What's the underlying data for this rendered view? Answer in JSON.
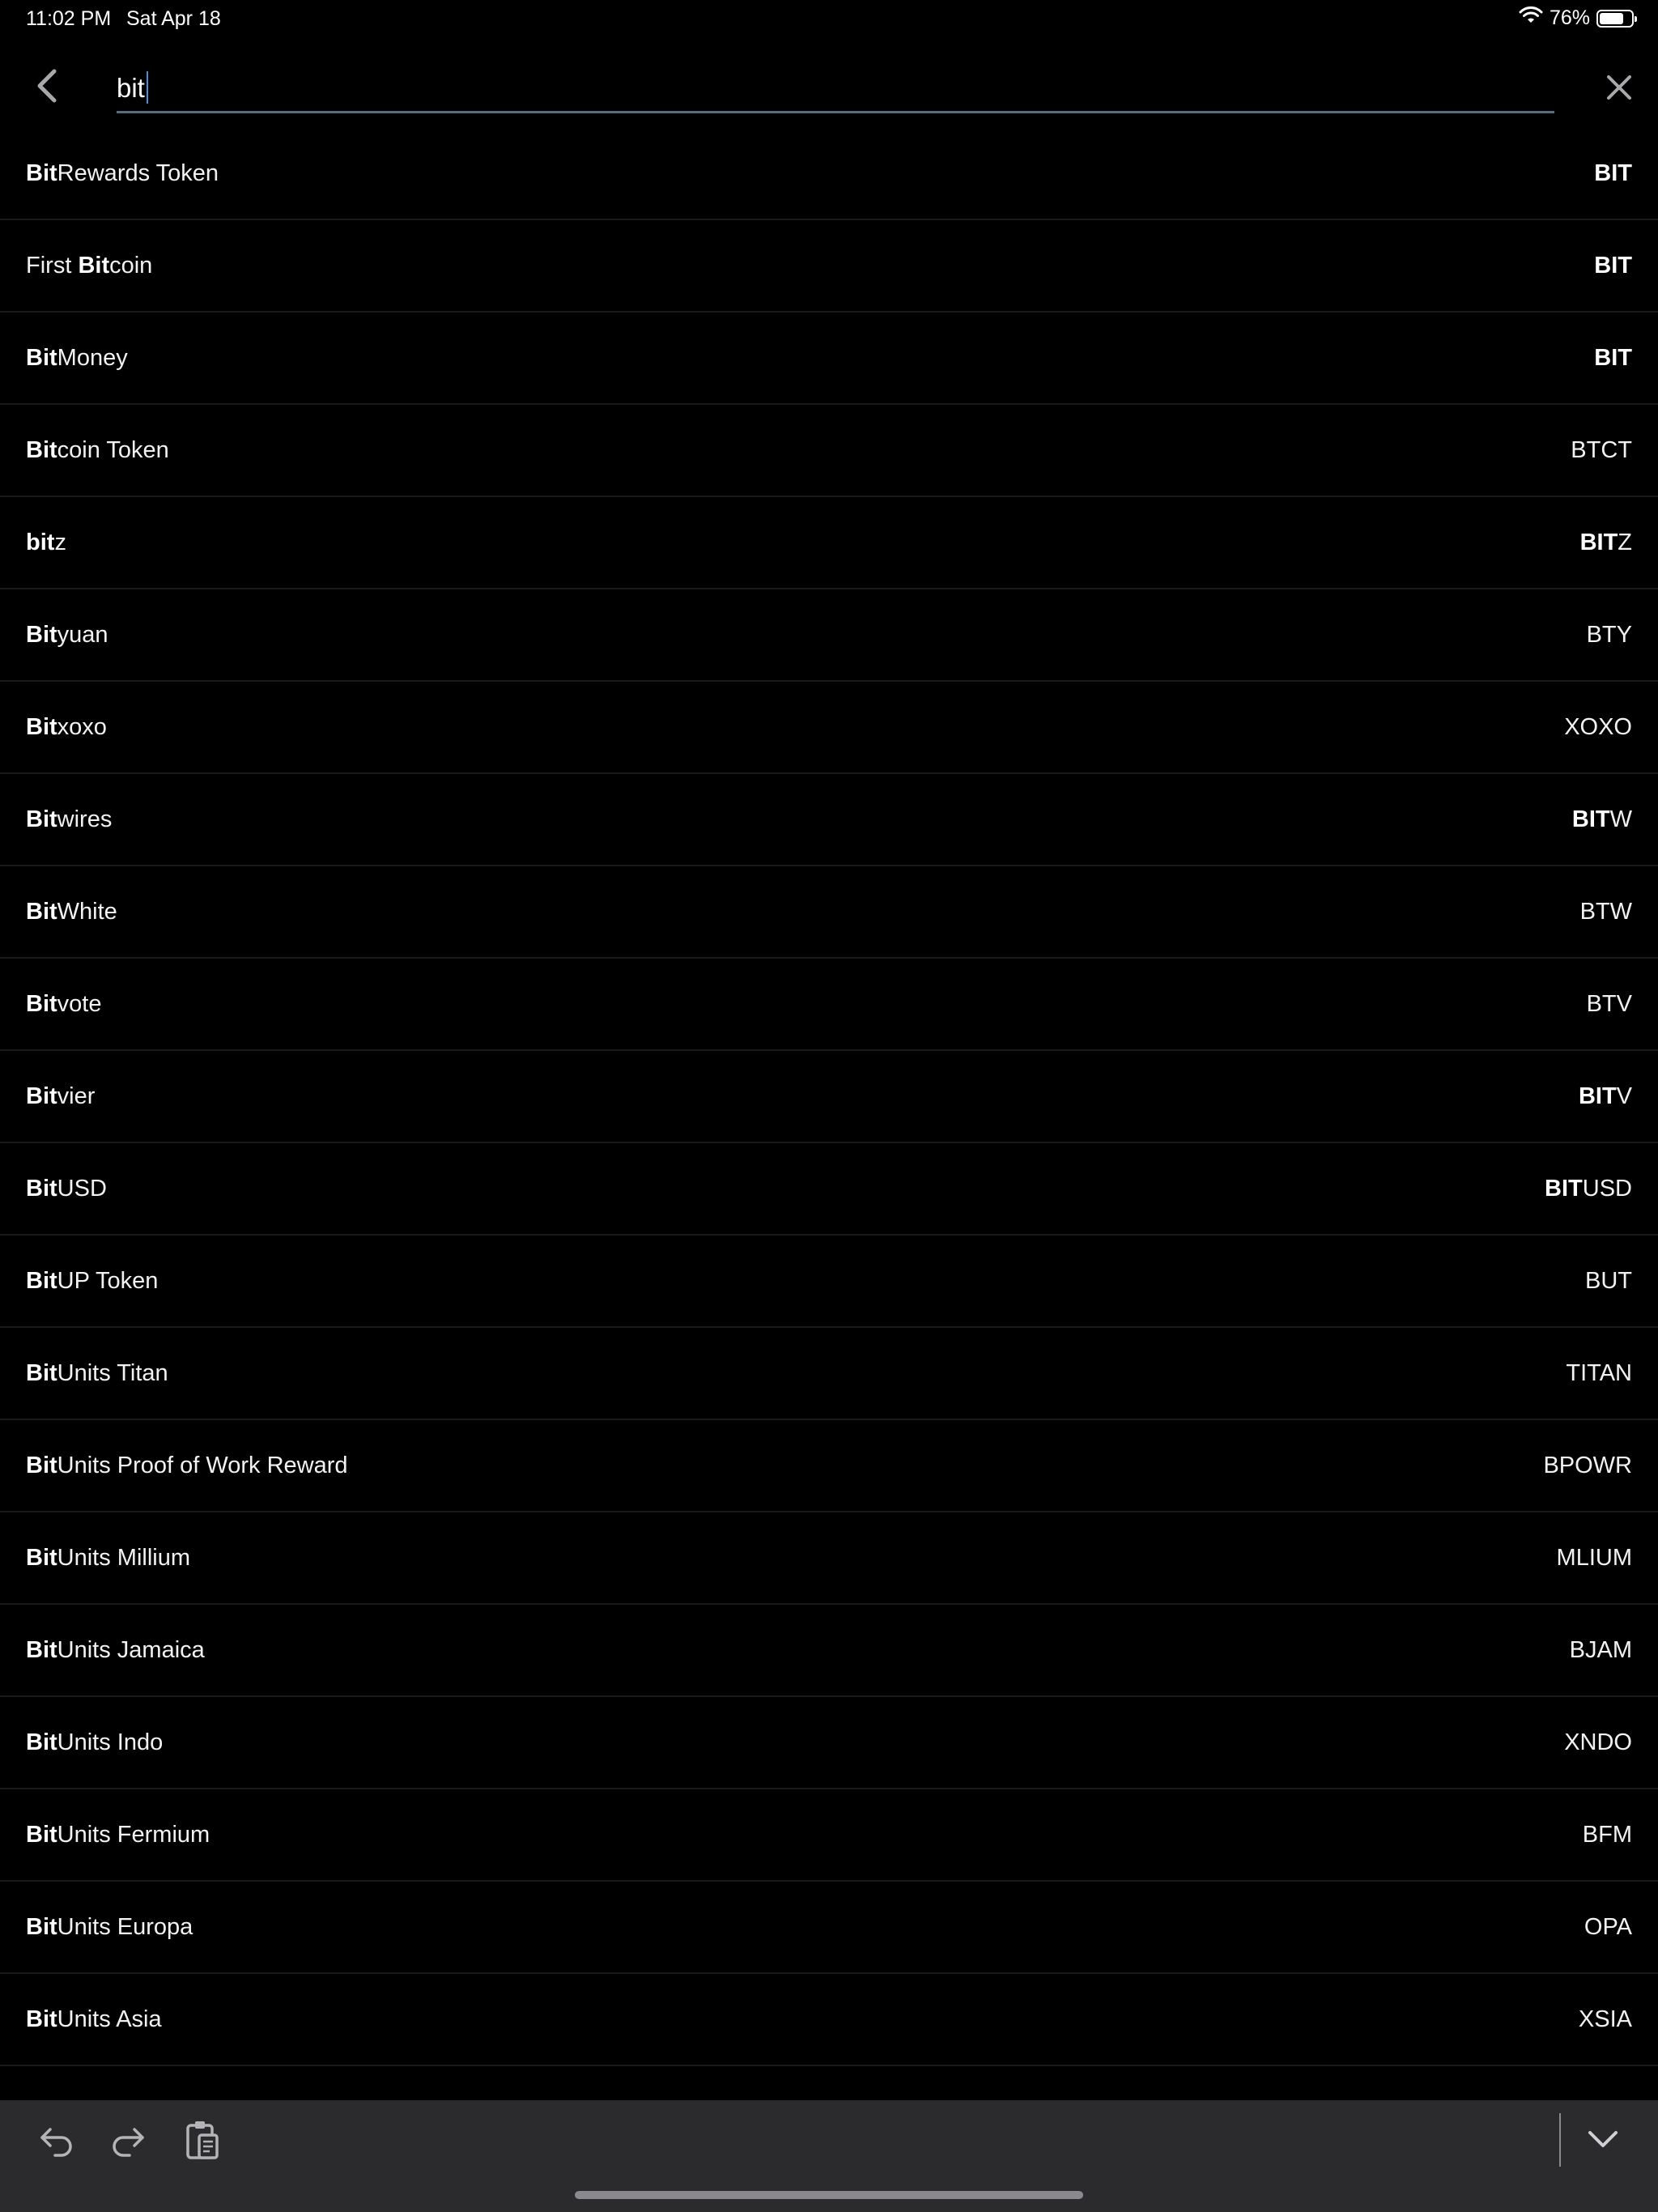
{
  "status": {
    "time": "11:02 PM",
    "date": "Sat Apr 18",
    "battery": "76%",
    "battery_level": 0.76
  },
  "search": {
    "query": "bit",
    "back_icon": "chevron-left-icon",
    "clear_icon": "close-icon"
  },
  "results": [
    {
      "name_pre": "",
      "name_bold": "Bit",
      "name_post": "Rewards Token",
      "sym_bold": "BIT",
      "sym_post": ""
    },
    {
      "name_pre": "First ",
      "name_bold": "Bit",
      "name_post": "coin",
      "sym_bold": "BIT",
      "sym_post": ""
    },
    {
      "name_pre": "",
      "name_bold": "Bit",
      "name_post": "Money",
      "sym_bold": "BIT",
      "sym_post": ""
    },
    {
      "name_pre": "",
      "name_bold": "Bit",
      "name_post": "coin Token",
      "sym_bold": "",
      "sym_post": "BTCT"
    },
    {
      "name_pre": "",
      "name_bold": "bit",
      "name_post": "z",
      "sym_bold": "BIT",
      "sym_post": "Z"
    },
    {
      "name_pre": "",
      "name_bold": "Bit",
      "name_post": "yuan",
      "sym_bold": "",
      "sym_post": "BTY"
    },
    {
      "name_pre": "",
      "name_bold": "Bit",
      "name_post": "xoxo",
      "sym_bold": "",
      "sym_post": "XOXO"
    },
    {
      "name_pre": "",
      "name_bold": "Bit",
      "name_post": "wires",
      "sym_bold": "BIT",
      "sym_post": "W"
    },
    {
      "name_pre": "",
      "name_bold": "Bit",
      "name_post": "White",
      "sym_bold": "",
      "sym_post": "BTW"
    },
    {
      "name_pre": "",
      "name_bold": "Bit",
      "name_post": "vote",
      "sym_bold": "",
      "sym_post": "BTV"
    },
    {
      "name_pre": "",
      "name_bold": "Bit",
      "name_post": "vier",
      "sym_bold": "BIT",
      "sym_post": "V"
    },
    {
      "name_pre": "",
      "name_bold": "Bit",
      "name_post": "USD",
      "sym_bold": "BIT",
      "sym_post": "USD"
    },
    {
      "name_pre": "",
      "name_bold": "Bit",
      "name_post": "UP Token",
      "sym_bold": "",
      "sym_post": "BUT"
    },
    {
      "name_pre": "",
      "name_bold": "Bit",
      "name_post": "Units Titan",
      "sym_bold": "",
      "sym_post": "TITAN"
    },
    {
      "name_pre": "",
      "name_bold": "Bit",
      "name_post": "Units Proof of Work Reward",
      "sym_bold": "",
      "sym_post": "BPOWR"
    },
    {
      "name_pre": "",
      "name_bold": "Bit",
      "name_post": "Units Millium",
      "sym_bold": "",
      "sym_post": "MLIUM"
    },
    {
      "name_pre": "",
      "name_bold": "Bit",
      "name_post": "Units Jamaica",
      "sym_bold": "",
      "sym_post": "BJAM"
    },
    {
      "name_pre": "",
      "name_bold": "Bit",
      "name_post": "Units Indo",
      "sym_bold": "",
      "sym_post": "XNDO"
    },
    {
      "name_pre": "",
      "name_bold": "Bit",
      "name_post": "Units Fermium",
      "sym_bold": "",
      "sym_post": "BFM"
    },
    {
      "name_pre": "",
      "name_bold": "Bit",
      "name_post": "Units Europa",
      "sym_bold": "",
      "sym_post": "OPA"
    },
    {
      "name_pre": "",
      "name_bold": "Bit",
      "name_post": "Units Asia",
      "sym_bold": "",
      "sym_post": "XSIA"
    }
  ],
  "keyboard_bar": {
    "undo_icon": "undo-icon",
    "redo_icon": "redo-icon",
    "paste_icon": "clipboard-paste-icon",
    "dismiss_icon": "keyboard-dismiss-chevron-icon"
  }
}
